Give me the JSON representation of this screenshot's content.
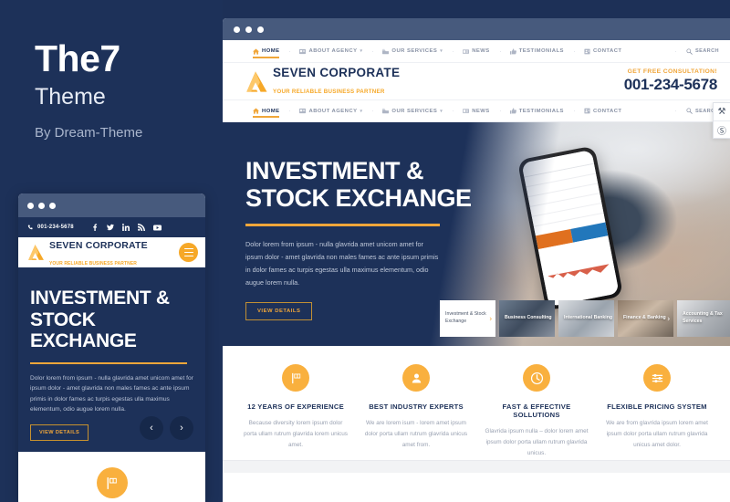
{
  "left_panel": {
    "title": "The7",
    "subtitle": "Theme",
    "byline": "By Dream-Theme"
  },
  "colors": {
    "navy": "#1d3159",
    "orange": "#f0a63a",
    "amber": "#f9b03e",
    "chrome": "#475a7d",
    "muted_text": "#9aa2b2"
  },
  "site": {
    "logo": {
      "name": "SEVEN CORPORATE",
      "tagline": "YOUR RELIABLE BUSINESS PARTNER",
      "mark_icon": "triangle-a-logo"
    },
    "cta": {
      "label": "GET FREE CONSULTATION!",
      "phone": "001-234-5678"
    },
    "nav": [
      {
        "label": "HOME",
        "icon": "home-icon",
        "active": true,
        "caret": false
      },
      {
        "label": "ABOUT AGENCY",
        "icon": "id-card-icon",
        "active": false,
        "caret": true
      },
      {
        "label": "OUR SERVICES",
        "icon": "briefcase-icon",
        "active": false,
        "caret": true
      },
      {
        "label": "NEWS",
        "icon": "newspaper-icon",
        "active": false,
        "caret": false
      },
      {
        "label": "TESTIMONIALS",
        "icon": "thumbs-up-icon",
        "active": false,
        "caret": false
      },
      {
        "label": "CONTACT",
        "icon": "contact-card-icon",
        "active": false,
        "caret": false
      }
    ],
    "search": {
      "label": "SEARCH",
      "icon": "search-icon"
    },
    "hero": {
      "title_line1": "INVESTMENT &",
      "title_line2": "STOCK EXCHANGE",
      "body": "Dolor lorem from ipsum - nulla glavrida amet unicom amet for ipsum dolor - amet glavrida non males fames ac ante ipsum primis in dolor fames ac turpis egestas ulla maximus elementum, odio augue lorem nulla.",
      "button": "VIEW DETAILS",
      "photo_alt": "hands-holding-smartphone-trading-app"
    },
    "carousel": [
      {
        "label": "Investment & Stock Exchange",
        "active": true
      },
      {
        "label": "Business Consulting",
        "active": false
      },
      {
        "label": "International Banking",
        "active": false
      },
      {
        "label": "Finance & Banking",
        "active": false
      },
      {
        "label": "Accounting & Tax Services",
        "active": false
      }
    ],
    "features": [
      {
        "icon": "flag-icon",
        "title": "12 YEARS OF EXPERIENCE",
        "body": "Because diversity lorem ipsum dolor porta ullam rutrum glavrida lorem unicus amet."
      },
      {
        "icon": "user-icon",
        "title": "BEST INDUSTRY EXPERTS",
        "body": "We are lorem isum -  lorem amet ipsum dolor porta ullam rutrum glavrida unicus amet from."
      },
      {
        "icon": "clock-icon",
        "title": "FAST & EFFECTIVE SOLLUTIONS",
        "body": "Glavrida ipsum nulla – dolor lorem amet  ipsum dolor porta ullam rutrum glavrida unicus."
      },
      {
        "icon": "sliders-icon",
        "title": "FLEXIBLE PRICING SYSTEM",
        "body": "We are from glavrida ipsum lorem amet  ipsum dolor porta ullam rutrum glavrida unicus amet dolor."
      }
    ]
  },
  "mobile": {
    "topbar": {
      "phone": "001-234-5678",
      "phone_icon": "phone-icon",
      "social": [
        "facebook-icon",
        "twitter-icon",
        "linkedin-icon",
        "rss-icon",
        "youtube-icon"
      ],
      "social_glyphs": [
        "f",
        "ᵛ",
        "in",
        "◔",
        "▶"
      ]
    },
    "menu_icon": "hamburger-menu-icon",
    "hero": {
      "title_line1": "INVESTMENT &",
      "title_line2": "STOCK",
      "title_line3": "EXCHANGE",
      "body": "Dolor lorem from ipsum - nulla glavrida amet unicom amet for ipsum dolor - amet glavrida non males fames ac ante ipsum primis in dolor fames ac turpis egestas ulla maximus elementum, odio augue lorem nulla.",
      "button": "VIEW DETAILS",
      "prev_icon": "chevron-left-icon",
      "next_icon": "chevron-right-icon",
      "prev_glyph": "‹",
      "next_glyph": "›"
    },
    "feature_icon": "flag-icon"
  },
  "tools_panel": [
    {
      "icon": "tools-icon",
      "glyph": "⚒"
    },
    {
      "icon": "settings-coin-icon",
      "glyph": "Ⓢ"
    }
  ]
}
